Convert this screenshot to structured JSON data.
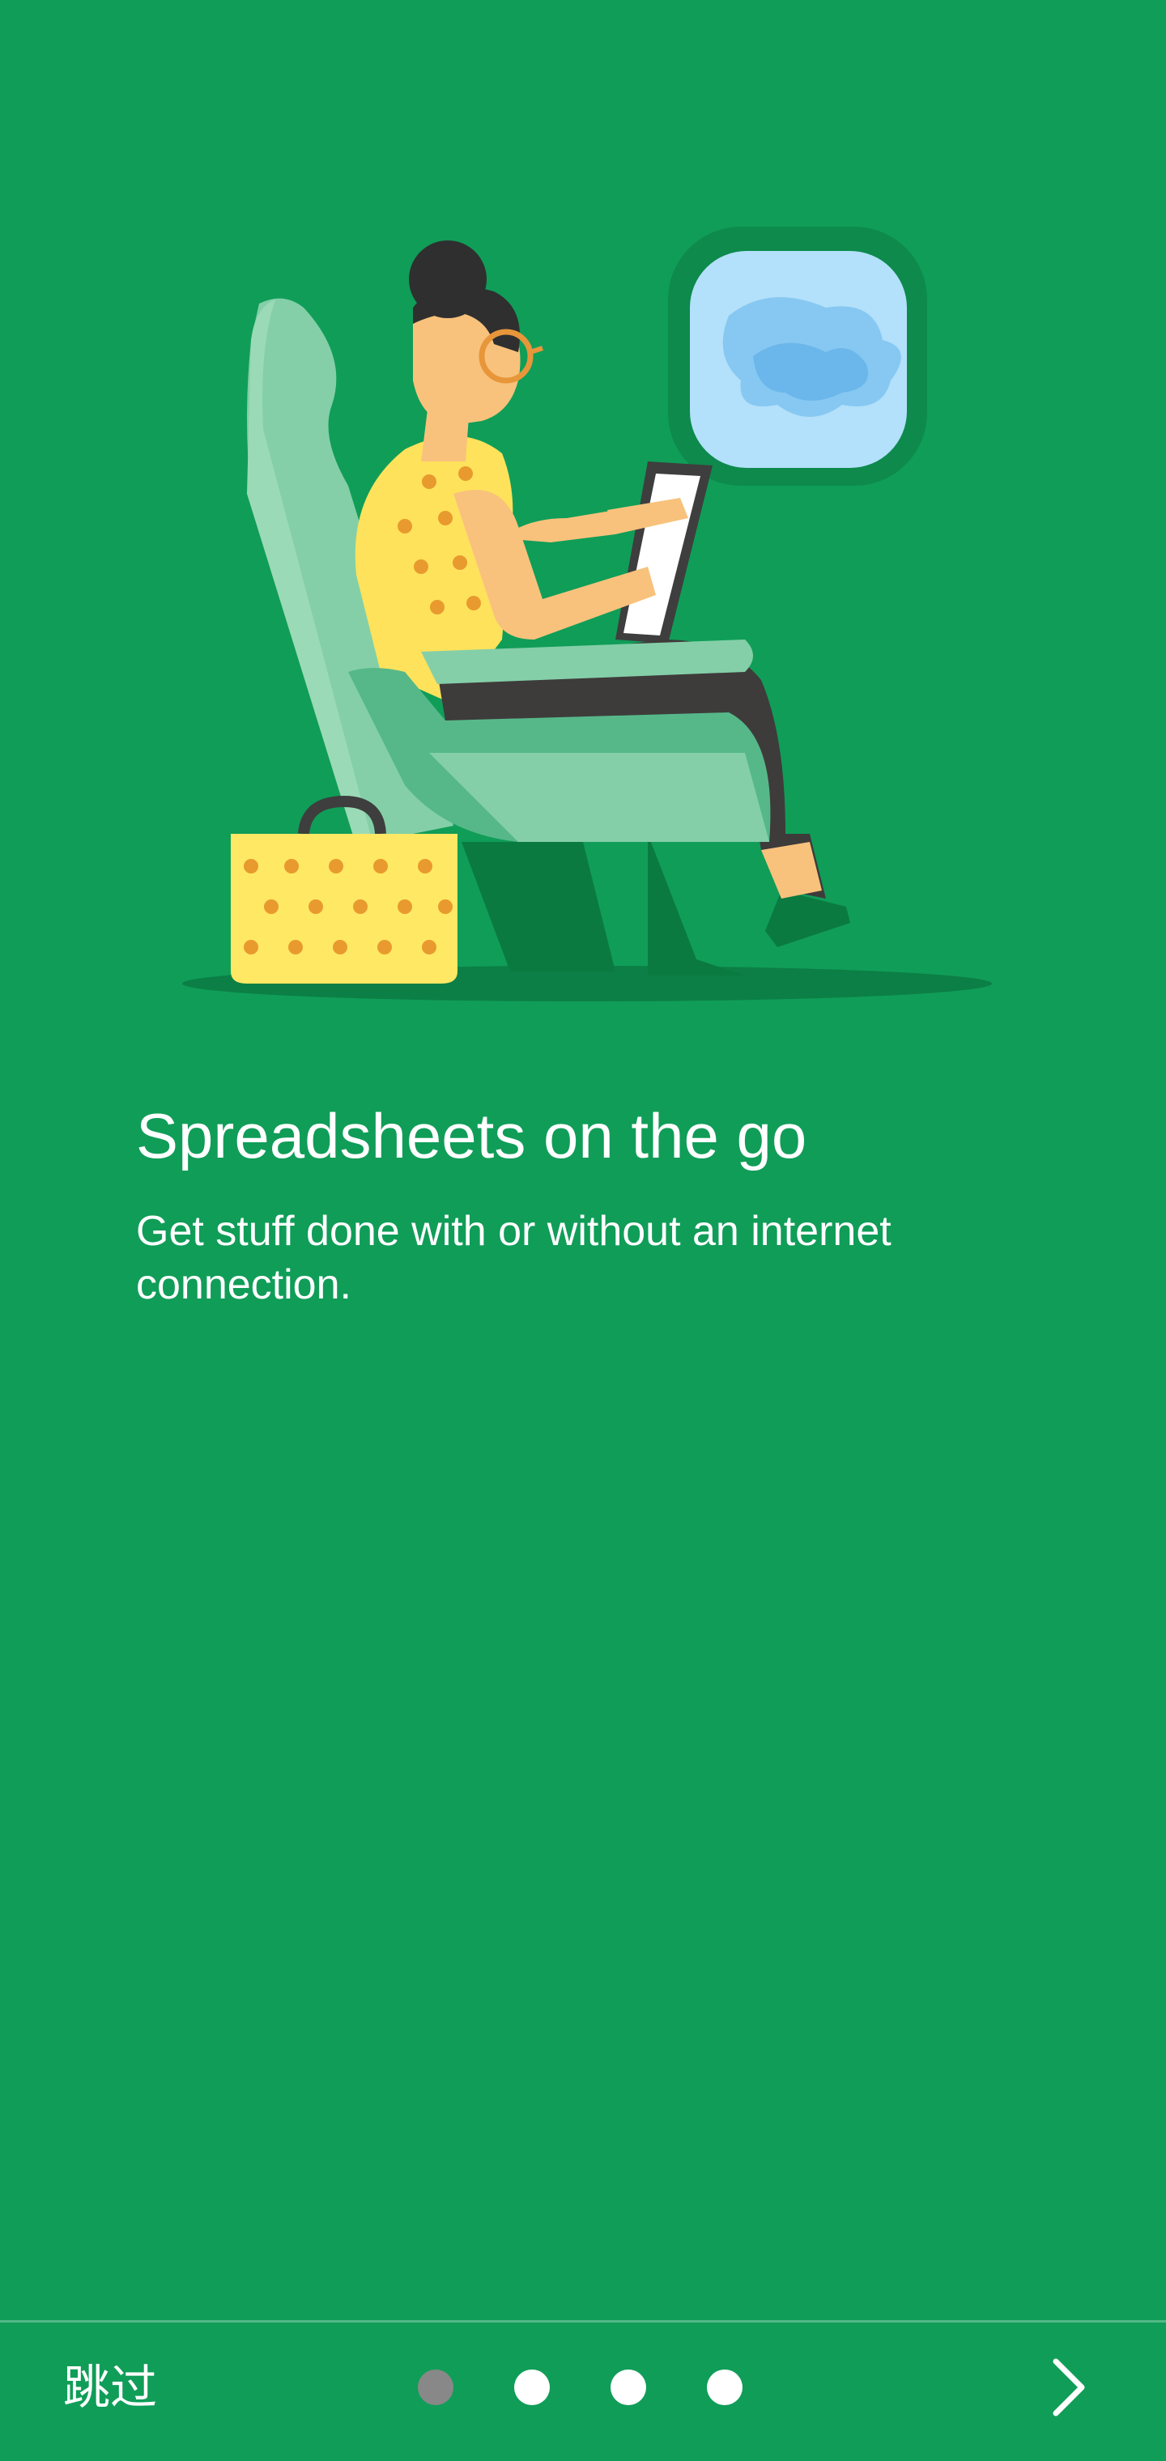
{
  "onboarding": {
    "title": "Spreadsheets on the go",
    "subtitle": "Get stuff done with or without an internet connection."
  },
  "footer": {
    "skip_label": "跳过",
    "page_count": 4,
    "current_page": 1,
    "next_icon": "chevron-right-icon"
  },
  "illustration": {
    "description_icon": "woman-on-plane-illustration"
  },
  "colors": {
    "background": "#109d58",
    "text": "#ffffff",
    "active_dot": "#888888",
    "inactive_dot": "#ffffff"
  }
}
